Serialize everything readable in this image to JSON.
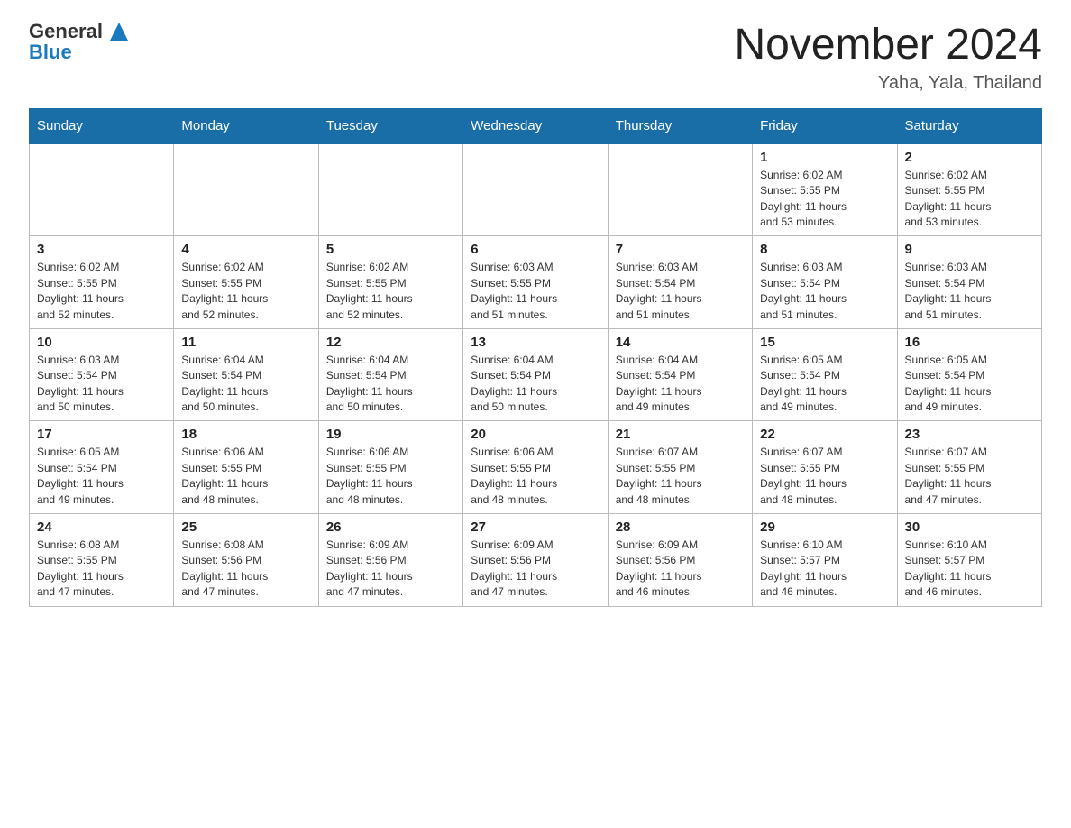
{
  "header": {
    "logo_general": "General",
    "logo_blue": "Blue",
    "title": "November 2024",
    "subtitle": "Yaha, Yala, Thailand"
  },
  "days_of_week": [
    "Sunday",
    "Monday",
    "Tuesday",
    "Wednesday",
    "Thursday",
    "Friday",
    "Saturday"
  ],
  "weeks": [
    [
      {
        "day": "",
        "info": ""
      },
      {
        "day": "",
        "info": ""
      },
      {
        "day": "",
        "info": ""
      },
      {
        "day": "",
        "info": ""
      },
      {
        "day": "",
        "info": ""
      },
      {
        "day": "1",
        "info": "Sunrise: 6:02 AM\nSunset: 5:55 PM\nDaylight: 11 hours\nand 53 minutes."
      },
      {
        "day": "2",
        "info": "Sunrise: 6:02 AM\nSunset: 5:55 PM\nDaylight: 11 hours\nand 53 minutes."
      }
    ],
    [
      {
        "day": "3",
        "info": "Sunrise: 6:02 AM\nSunset: 5:55 PM\nDaylight: 11 hours\nand 52 minutes."
      },
      {
        "day": "4",
        "info": "Sunrise: 6:02 AM\nSunset: 5:55 PM\nDaylight: 11 hours\nand 52 minutes."
      },
      {
        "day": "5",
        "info": "Sunrise: 6:02 AM\nSunset: 5:55 PM\nDaylight: 11 hours\nand 52 minutes."
      },
      {
        "day": "6",
        "info": "Sunrise: 6:03 AM\nSunset: 5:55 PM\nDaylight: 11 hours\nand 51 minutes."
      },
      {
        "day": "7",
        "info": "Sunrise: 6:03 AM\nSunset: 5:54 PM\nDaylight: 11 hours\nand 51 minutes."
      },
      {
        "day": "8",
        "info": "Sunrise: 6:03 AM\nSunset: 5:54 PM\nDaylight: 11 hours\nand 51 minutes."
      },
      {
        "day": "9",
        "info": "Sunrise: 6:03 AM\nSunset: 5:54 PM\nDaylight: 11 hours\nand 51 minutes."
      }
    ],
    [
      {
        "day": "10",
        "info": "Sunrise: 6:03 AM\nSunset: 5:54 PM\nDaylight: 11 hours\nand 50 minutes."
      },
      {
        "day": "11",
        "info": "Sunrise: 6:04 AM\nSunset: 5:54 PM\nDaylight: 11 hours\nand 50 minutes."
      },
      {
        "day": "12",
        "info": "Sunrise: 6:04 AM\nSunset: 5:54 PM\nDaylight: 11 hours\nand 50 minutes."
      },
      {
        "day": "13",
        "info": "Sunrise: 6:04 AM\nSunset: 5:54 PM\nDaylight: 11 hours\nand 50 minutes."
      },
      {
        "day": "14",
        "info": "Sunrise: 6:04 AM\nSunset: 5:54 PM\nDaylight: 11 hours\nand 49 minutes."
      },
      {
        "day": "15",
        "info": "Sunrise: 6:05 AM\nSunset: 5:54 PM\nDaylight: 11 hours\nand 49 minutes."
      },
      {
        "day": "16",
        "info": "Sunrise: 6:05 AM\nSunset: 5:54 PM\nDaylight: 11 hours\nand 49 minutes."
      }
    ],
    [
      {
        "day": "17",
        "info": "Sunrise: 6:05 AM\nSunset: 5:54 PM\nDaylight: 11 hours\nand 49 minutes."
      },
      {
        "day": "18",
        "info": "Sunrise: 6:06 AM\nSunset: 5:55 PM\nDaylight: 11 hours\nand 48 minutes."
      },
      {
        "day": "19",
        "info": "Sunrise: 6:06 AM\nSunset: 5:55 PM\nDaylight: 11 hours\nand 48 minutes."
      },
      {
        "day": "20",
        "info": "Sunrise: 6:06 AM\nSunset: 5:55 PM\nDaylight: 11 hours\nand 48 minutes."
      },
      {
        "day": "21",
        "info": "Sunrise: 6:07 AM\nSunset: 5:55 PM\nDaylight: 11 hours\nand 48 minutes."
      },
      {
        "day": "22",
        "info": "Sunrise: 6:07 AM\nSunset: 5:55 PM\nDaylight: 11 hours\nand 48 minutes."
      },
      {
        "day": "23",
        "info": "Sunrise: 6:07 AM\nSunset: 5:55 PM\nDaylight: 11 hours\nand 47 minutes."
      }
    ],
    [
      {
        "day": "24",
        "info": "Sunrise: 6:08 AM\nSunset: 5:55 PM\nDaylight: 11 hours\nand 47 minutes."
      },
      {
        "day": "25",
        "info": "Sunrise: 6:08 AM\nSunset: 5:56 PM\nDaylight: 11 hours\nand 47 minutes."
      },
      {
        "day": "26",
        "info": "Sunrise: 6:09 AM\nSunset: 5:56 PM\nDaylight: 11 hours\nand 47 minutes."
      },
      {
        "day": "27",
        "info": "Sunrise: 6:09 AM\nSunset: 5:56 PM\nDaylight: 11 hours\nand 47 minutes."
      },
      {
        "day": "28",
        "info": "Sunrise: 6:09 AM\nSunset: 5:56 PM\nDaylight: 11 hours\nand 46 minutes."
      },
      {
        "day": "29",
        "info": "Sunrise: 6:10 AM\nSunset: 5:57 PM\nDaylight: 11 hours\nand 46 minutes."
      },
      {
        "day": "30",
        "info": "Sunrise: 6:10 AM\nSunset: 5:57 PM\nDaylight: 11 hours\nand 46 minutes."
      }
    ]
  ]
}
